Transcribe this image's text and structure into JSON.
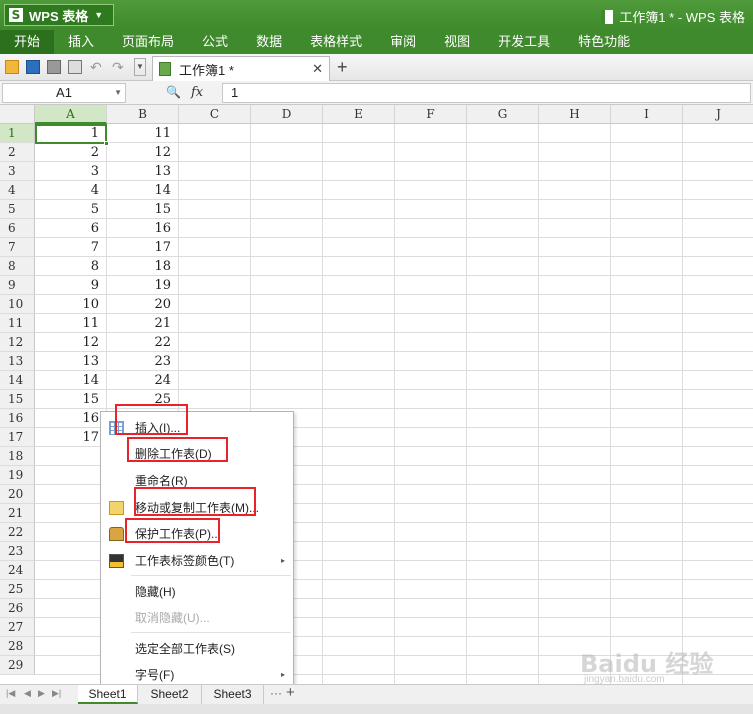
{
  "app": {
    "button_label": "WPS 表格",
    "logo_glyph": "S",
    "window_title": "工作簿1 * - WPS 表格"
  },
  "menu": [
    "开始",
    "插入",
    "页面布局",
    "公式",
    "数据",
    "表格样式",
    "审阅",
    "视图",
    "开发工具",
    "特色功能"
  ],
  "toolbar": {
    "doc_tab_label": "工作簿1 *",
    "doc_tab_close": "✕",
    "new_tab": "+"
  },
  "formula_bar": {
    "name_box": "A1",
    "fx_label": "fx",
    "value": "1"
  },
  "columns": [
    "A",
    "B",
    "C",
    "D",
    "E",
    "F",
    "G",
    "H",
    "I",
    "J"
  ],
  "row_numbers": [
    "1",
    "2",
    "3",
    "4",
    "5",
    "6",
    "7",
    "8",
    "9",
    "10",
    "11",
    "12",
    "13",
    "14",
    "15",
    "16",
    "17",
    "18",
    "19",
    "20",
    "21",
    "22",
    "23",
    "24",
    "25",
    "26",
    "27",
    "28",
    "29"
  ],
  "cells": {
    "A": [
      "1",
      "2",
      "3",
      "4",
      "5",
      "6",
      "7",
      "8",
      "9",
      "10",
      "11",
      "12",
      "13",
      "14",
      "15",
      "16",
      "17"
    ],
    "B": [
      "11",
      "12",
      "13",
      "14",
      "15",
      "16",
      "17",
      "18",
      "19",
      "20",
      "21",
      "22",
      "23",
      "24",
      "25"
    ]
  },
  "context_menu": {
    "items": [
      {
        "label": "插入(I)...",
        "icon": "insert-icon",
        "enabled": true,
        "submenu": false
      },
      {
        "label": "删除工作表(D)",
        "icon": "",
        "enabled": true,
        "submenu": false
      },
      {
        "label": "重命名(R)",
        "icon": "",
        "enabled": true,
        "submenu": false
      },
      {
        "label": "移动或复制工作表(M)...",
        "icon": "move-copy-icon",
        "enabled": true,
        "submenu": false
      },
      {
        "label": "保护工作表(P)...",
        "icon": "lock-icon",
        "enabled": true,
        "submenu": false
      },
      {
        "label": "工作表标签颜色(T)",
        "icon": "tab-color-icon",
        "enabled": true,
        "submenu": true
      },
      {
        "label": "隐藏(H)",
        "icon": "",
        "enabled": true,
        "submenu": false
      },
      {
        "label": "取消隐藏(U)...",
        "icon": "",
        "enabled": false,
        "submenu": false
      },
      {
        "label": "选定全部工作表(S)",
        "icon": "",
        "enabled": true,
        "submenu": false
      },
      {
        "label": "字号(F)",
        "icon": "",
        "enabled": true,
        "submenu": true
      }
    ],
    "submenu_arrow": "▸"
  },
  "sheets": {
    "tabs": [
      "Sheet1",
      "Sheet2",
      "Sheet3"
    ],
    "active": "Sheet1",
    "more": "···",
    "add": "+"
  },
  "watermark": {
    "main": "Baidu 经验",
    "sub": "jingyan.baidu.com"
  },
  "colors": {
    "brand_green": "#3f8a2c",
    "highlight_red": "#e8232a"
  }
}
